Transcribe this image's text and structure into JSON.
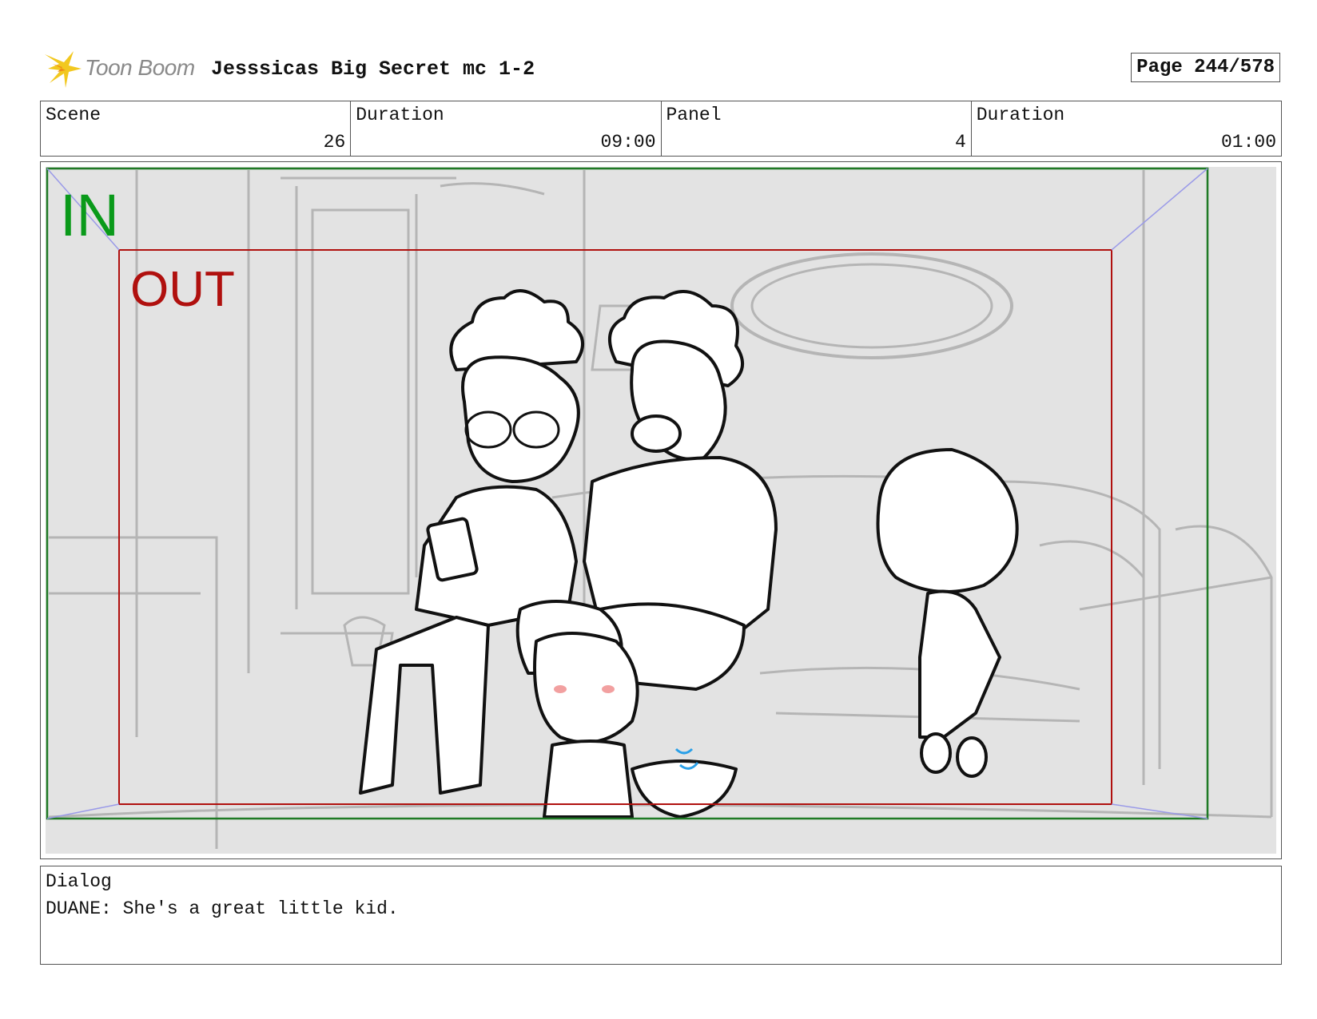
{
  "header": {
    "logo_text": "Toon Boom",
    "title": "Jesssicas Big Secret mc 1-2",
    "page": "Page 244/578"
  },
  "info": {
    "scene_label": "Scene",
    "scene_value": "26",
    "scene_duration_label": "Duration",
    "scene_duration_value": "09:00",
    "panel_label": "Panel",
    "panel_value": "4",
    "panel_duration_label": "Duration",
    "panel_duration_value": "01:00"
  },
  "frame": {
    "in_label": "IN",
    "out_label": "OUT",
    "in_color": "#0a9a1a",
    "out_color": "#b0100e"
  },
  "dialog": {
    "label": "Dialog",
    "text": "DUANE: She's a great little kid."
  }
}
